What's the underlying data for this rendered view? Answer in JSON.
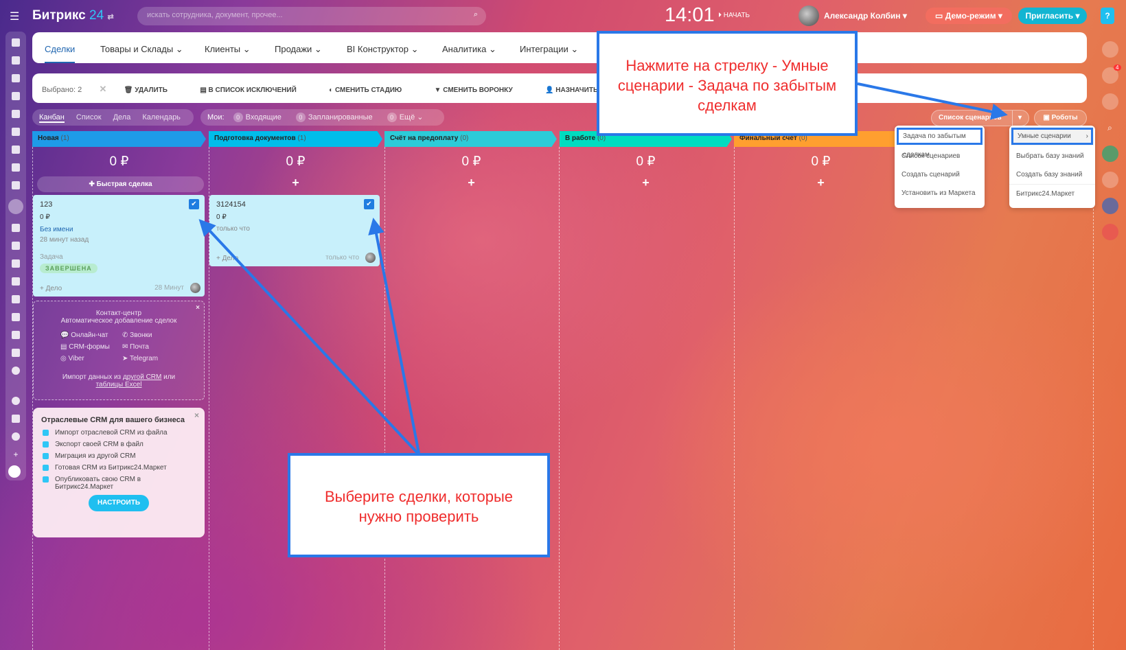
{
  "header": {
    "logo_text": "Битрикс",
    "logo_num": "24",
    "search_placeholder": "искать сотрудника, документ, прочее...",
    "clock": "14:01",
    "start_label": "НАЧАТЬ",
    "user_name": "Александр Колбин",
    "demo_label": "Демо-режим",
    "invite_label": "Пригласить",
    "help": "?",
    "notifications_count": "4"
  },
  "tabs": [
    {
      "label": "Сделки"
    },
    {
      "label": "Товары и Склады"
    },
    {
      "label": "Клиенты"
    },
    {
      "label": "Продажи"
    },
    {
      "label": "BI Конструктор"
    },
    {
      "label": "Аналитика"
    },
    {
      "label": "Интеграции"
    }
  ],
  "actions": {
    "selected": "Выбрано: 2",
    "delete": "УДАЛИТЬ",
    "exclude": "В СПИСОК ИСКЛЮЧЕНИЙ",
    "stage": "СМЕНИТЬ СТАДИЮ",
    "funnel": "СМЕНИТЬ ВОРОНКУ",
    "assign": "НАЗНАЧИТЬ ОТВЕТСТВЕННОГО"
  },
  "views": [
    "Канбан",
    "Список",
    "Дела",
    "Календарь"
  ],
  "filters": {
    "my": "Мои:",
    "incoming": "Входящие",
    "incoming_count": "0",
    "planned": "Запланированные",
    "planned_count": "0",
    "more": "Ещё",
    "more_count": "0"
  },
  "scenarios": {
    "list_label": "Список сценариев",
    "robots_label": "Роботы"
  },
  "menu1": [
    "Задача по забытым сделкам",
    "Список сценариев",
    "Создать сценарий",
    "Установить из Маркета"
  ],
  "menu2": [
    "Умные сценарии",
    "Выбрать базу знаний",
    "Создать базу знаний",
    "Битрикс24.Маркет"
  ],
  "columns": [
    {
      "name": "Новая",
      "count": "(1)",
      "sum": "0 ₽",
      "color": "#1e9be8"
    },
    {
      "name": "Подготовка документов",
      "count": "(1)",
      "sum": "0 ₽",
      "color": "#00bdea"
    },
    {
      "name": "Счёт на предоплату",
      "count": "(0)",
      "sum": "0 ₽",
      "color": "#2ccbd8"
    },
    {
      "name": "В работе",
      "count": "(0)",
      "sum": "0 ₽",
      "color": "#00dcc0"
    },
    {
      "name": "Финальный счёт",
      "count": "(0)",
      "sum": "0 ₽",
      "color": "#ff9f2f"
    }
  ],
  "quick_deal": "Быстрая сделка",
  "cards": [
    {
      "title": "123",
      "sum": "0 ₽",
      "client": "Без имени",
      "time": "28 минут назад",
      "task_label": "Задача",
      "status": "ЗАВЕРШЕНА",
      "add": "+ Дело",
      "footer_time": "28 Минут"
    },
    {
      "title": "3124154",
      "sum": "0 ₽",
      "time": "только что",
      "add": "+ Дело",
      "footer_time": "только что"
    }
  ],
  "contact_center": {
    "title": "Контакт-центр",
    "subtitle": "Автоматическое добавление сделок",
    "items": [
      "Онлайн-чат",
      "Звонки",
      "CRM-формы",
      "Почта",
      "Viber",
      "Telegram"
    ],
    "import_text": "Импорт данных из",
    "link1": "другой CRM",
    "or": "или",
    "link2": "таблицы Excel"
  },
  "industry": {
    "title": "Отраслевые CRM для вашего бизнеса",
    "items": [
      "Импорт отраслевой CRM из файла",
      "Экспорт своей CRM в файл",
      "Миграция из другой CRM",
      "Готовая CRM из Битрикс24.Маркет",
      "Опубликовать свою CRM в Битрикс24.Маркет"
    ],
    "button": "НАСТРОИТЬ"
  },
  "annotations": {
    "top": "Нажмите на стрелку - Умные сценарии - Задача по забытым сделкам",
    "bottom": "Выберите сделки, которые нужно проверить"
  },
  "colors": {
    "annotation_border": "#2a78e8",
    "annotation_text": "#ef2d2d",
    "checkbox": "#1f7de0"
  }
}
